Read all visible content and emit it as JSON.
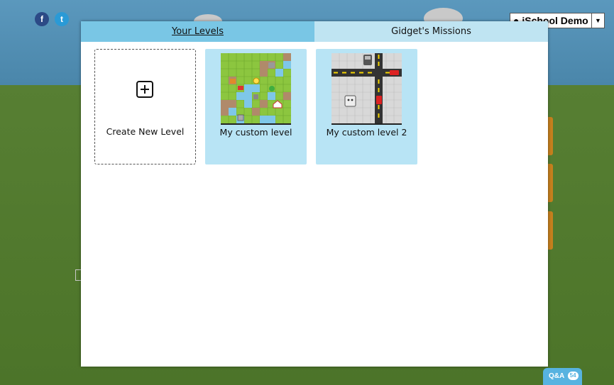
{
  "header": {
    "facebook_glyph": "f",
    "twitter_glyph": "t",
    "user_menu_label": "iSchool Demo"
  },
  "modal": {
    "tabs": [
      {
        "label": "Your Levels",
        "active": true
      },
      {
        "label": "Gidget's Missions",
        "active": false
      }
    ],
    "create_label": "Create New Level",
    "levels": [
      {
        "label": "My custom level",
        "theme": "grass-water-map"
      },
      {
        "label": "My custom level 2",
        "theme": "road-map"
      }
    ]
  },
  "qa": {
    "label": "Q&A",
    "count": "54"
  },
  "colors": {
    "tab_active": "#79c6e5",
    "tab_inactive": "#bfe4f2",
    "card_bg": "#b8e4f5",
    "grass": "#8cc63f",
    "water": "#7ec7e8",
    "dirt": "#b08a6a",
    "road": "#333333",
    "road_line": "#f5d400"
  }
}
